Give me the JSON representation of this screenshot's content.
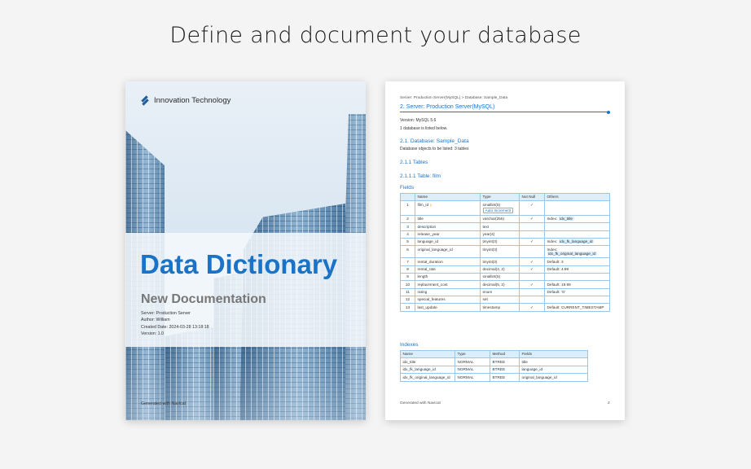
{
  "headline": "Define and document your database",
  "cover": {
    "brand": "Innovation Technology",
    "title": "Data Dictionary",
    "subtitle": "New Documentation",
    "meta": [
      "Server: Production Server",
      "Author: William",
      "Created Date: 2024-03-28 13:18:18",
      "Version: 1.0"
    ],
    "footer": "Generated with Navicat"
  },
  "doc": {
    "breadcrumb": "Server: Production Server(MySQL) > Database: Sample_Data",
    "section_title": "2. Server: Production Server(MySQL)",
    "version": "Version: MySQL 5.6",
    "db_note": "1 database is listed below.",
    "db_title": "2.1. Database: Sample_Data",
    "db_objects": "Database objects to be listed: 3 tables",
    "tables_heading": "2.1.1 Tables",
    "table_heading": "2.1.1.1 Table: film",
    "fields_heading": "Fields",
    "fields_columns": [
      "",
      "Name",
      "Type",
      "Not Null",
      "Others"
    ],
    "fields_rows": [
      {
        "n": "1",
        "name": "film_id",
        "key": true,
        "type": "smallint(5)",
        "tag": "Auto Increment",
        "notnull": "✓",
        "others_label": "",
        "others_value": ""
      },
      {
        "n": "2",
        "name": "title",
        "key": false,
        "type": "varchar(255)",
        "tag": "",
        "notnull": "✓",
        "others_label": "Index:",
        "others_value": "idx_title"
      },
      {
        "n": "3",
        "name": "description",
        "key": false,
        "type": "text",
        "tag": "",
        "notnull": "",
        "others_label": "",
        "others_value": ""
      },
      {
        "n": "4",
        "name": "release_year",
        "key": false,
        "type": "year(4)",
        "tag": "",
        "notnull": "",
        "others_label": "",
        "others_value": ""
      },
      {
        "n": "5",
        "name": "language_id",
        "key": false,
        "type": "tinyint(3)",
        "tag": "",
        "notnull": "✓",
        "others_label": "Index:",
        "others_value": "idx_fk_language_id"
      },
      {
        "n": "6",
        "name": "original_language_id",
        "key": false,
        "type": "tinyint(3)",
        "tag": "",
        "notnull": "",
        "others_label": "Index:",
        "others_value": "idx_fk_original_language_id"
      },
      {
        "n": "7",
        "name": "rental_duration",
        "key": false,
        "type": "tinyint(3)",
        "tag": "",
        "notnull": "✓",
        "others_label": "Default: 3",
        "others_value": ""
      },
      {
        "n": "8",
        "name": "rental_rate",
        "key": false,
        "type": "decimal(4, 2)",
        "tag": "",
        "notnull": "✓",
        "others_label": "Default: 4.99",
        "others_value": ""
      },
      {
        "n": "9",
        "name": "length",
        "key": false,
        "type": "smallint(5)",
        "tag": "",
        "notnull": "",
        "others_label": "",
        "others_value": ""
      },
      {
        "n": "10",
        "name": "replacement_cost",
        "key": false,
        "type": "decimal(5, 2)",
        "tag": "",
        "notnull": "✓",
        "others_label": "Default: 19.99",
        "others_value": ""
      },
      {
        "n": "11",
        "name": "rating",
        "key": false,
        "type": "enum",
        "tag": "",
        "notnull": "",
        "others_label": "Default: 'G'",
        "others_value": ""
      },
      {
        "n": "12",
        "name": "special_features",
        "key": false,
        "type": "set",
        "tag": "",
        "notnull": "",
        "others_label": "",
        "others_value": ""
      },
      {
        "n": "13",
        "name": "last_update",
        "key": false,
        "type": "timestamp",
        "tag": "",
        "notnull": "✓",
        "others_label": "Default: CURRENT_TIMESTAMP",
        "others_value": ""
      }
    ],
    "indexes_heading": "Indexes",
    "indexes_columns": [
      "Name",
      "Type",
      "Method",
      "Fields"
    ],
    "indexes_rows": [
      [
        "idx_title",
        "NORMAL",
        "BTREE",
        "title"
      ],
      [
        "idx_fk_language_id",
        "NORMAL",
        "BTREE",
        "language_id"
      ],
      [
        "idx_fk_original_language_id",
        "NORMAL",
        "BTREE",
        "original_language_id"
      ]
    ],
    "footer": "Generated with Navicat",
    "page_number": "2"
  }
}
